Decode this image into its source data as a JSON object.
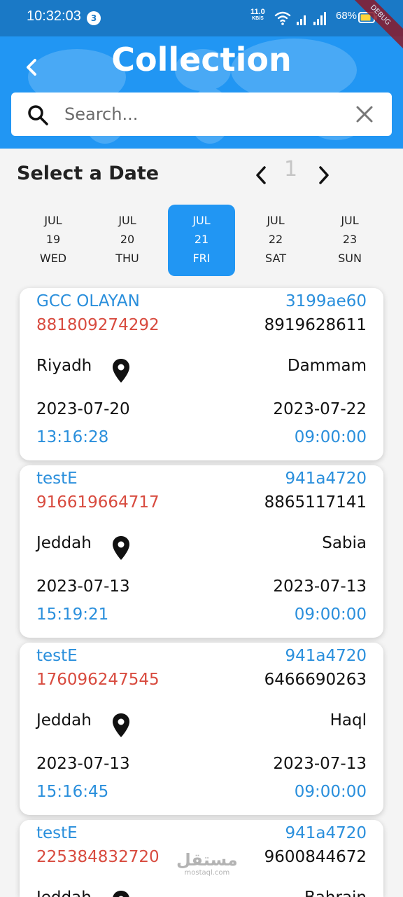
{
  "status_bar": {
    "time": "10:32:03",
    "notification_count": "3",
    "net_speed": "11.0",
    "net_unit": "KB/S",
    "battery": "68%",
    "debug_banner": "DEBUG"
  },
  "header": {
    "title": "Collection",
    "search_placeholder": "Search..."
  },
  "date_selector": {
    "title": "Select a Date",
    "page": "1",
    "days": [
      {
        "month": "JUL",
        "day": "19",
        "weekday": "WED",
        "active": false
      },
      {
        "month": "JUL",
        "day": "20",
        "weekday": "THU",
        "active": false
      },
      {
        "month": "JUL",
        "day": "21",
        "weekday": "FRI",
        "active": true
      },
      {
        "month": "JUL",
        "day": "22",
        "weekday": "SAT",
        "active": false
      },
      {
        "month": "JUL",
        "day": "23",
        "weekday": "SUN",
        "active": false
      }
    ]
  },
  "cards": [
    {
      "name": "GCC OLAYAN",
      "code": "3199ae60",
      "awb": "881809274292",
      "phone": "8919628611",
      "from": "Riyadh",
      "to": "Dammam",
      "date_from": "2023-07-20",
      "date_to": "2023-07-22",
      "time_from": "13:16:28",
      "time_to": "09:00:00"
    },
    {
      "name": "testE",
      "code": "941a4720",
      "awb": "916619664717",
      "phone": "8865117141",
      "from": "Jeddah",
      "to": "Sabia",
      "date_from": "2023-07-13",
      "date_to": "2023-07-13",
      "time_from": "15:19:21",
      "time_to": "09:00:00"
    },
    {
      "name": "testE",
      "code": "941a4720",
      "awb": "176096247545",
      "phone": "6466690263",
      "from": "Jeddah",
      "to": "Haql",
      "date_from": "2023-07-13",
      "date_to": "2023-07-13",
      "time_from": "15:16:45",
      "time_to": "09:00:00"
    },
    {
      "name": "testE",
      "code": "941a4720",
      "awb": "225384832720",
      "phone": "9600844672",
      "from": "Jeddah",
      "to": "Bahrain",
      "date_from": "",
      "date_to": "",
      "time_from": "",
      "time_to": ""
    }
  ],
  "watermark": {
    "arabic": "مستقل",
    "latin": "mostaql.com"
  },
  "colors": {
    "primary": "#2196f3",
    "accent_text": "#2a8fdc",
    "awb_red": "#d84b3f"
  }
}
